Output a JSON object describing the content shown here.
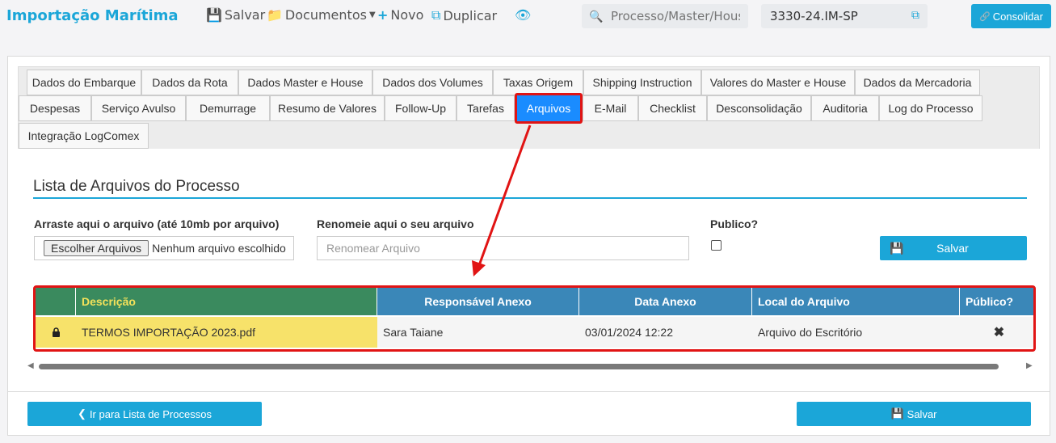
{
  "header": {
    "app_title": "Importação Marítima",
    "save_label": "Salvar",
    "documents_label": "Documentos",
    "new_label": "Novo",
    "duplicate_label": "Duplicar",
    "search_placeholder": "Processo/Master/House",
    "process_number": "3330-24.IM-SP",
    "consolidate_label": "Consolidar"
  },
  "tabs": [
    "Dados do Embarque",
    "Dados da Rota",
    "Dados Master e House",
    "Dados dos Volumes",
    "Taxas Origem",
    "Shipping Instruction",
    "Valores do Master e House",
    "Dados da Mercadoria",
    "Despesas",
    "Serviço Avulso",
    "Demurrage",
    "Resumo de Valores",
    "Follow-Up",
    "Tarefas",
    "Arquivos",
    "E-Mail",
    "Checklist",
    "Desconsolidação",
    "Auditoria",
    "Log do Processo",
    "Integração LogComex"
  ],
  "active_tab": "Arquivos",
  "files_section": {
    "title": "Lista de Arquivos do Processo",
    "drop_label": "Arraste aqui o arquivo (até 10mb por arquivo)",
    "choose_files_label": "Escolher Arquivos",
    "no_file_label": "Nenhum arquivo escolhido",
    "rename_label": "Renomeie aqui o seu arquivo",
    "rename_placeholder": "Renomear Arquivo",
    "public_label": "Publico?",
    "save_label": "Salvar"
  },
  "table": {
    "headers": [
      "",
      "Descrição",
      "Responsável Anexo",
      "Data Anexo",
      "Local do Arquivo",
      "Público?"
    ],
    "rows": [
      {
        "description": "TERMOS IMPORTAÇÃO 2023.pdf",
        "responsible": "Sara Taiane",
        "date": "03/01/2024 12:22",
        "location": "Arquivo do Escritório",
        "public": "✖"
      }
    ]
  },
  "footer": {
    "back_label": "Ir para Lista de Processos",
    "save_label": "Salvar"
  },
  "colors": {
    "accent": "#1ba6d8",
    "active_tab": "#1a8cff",
    "highlight_border": "#e11414",
    "header_green": "#3a8a5e",
    "header_blue": "#3a87b8",
    "row_yellow": "#f7e26a"
  }
}
